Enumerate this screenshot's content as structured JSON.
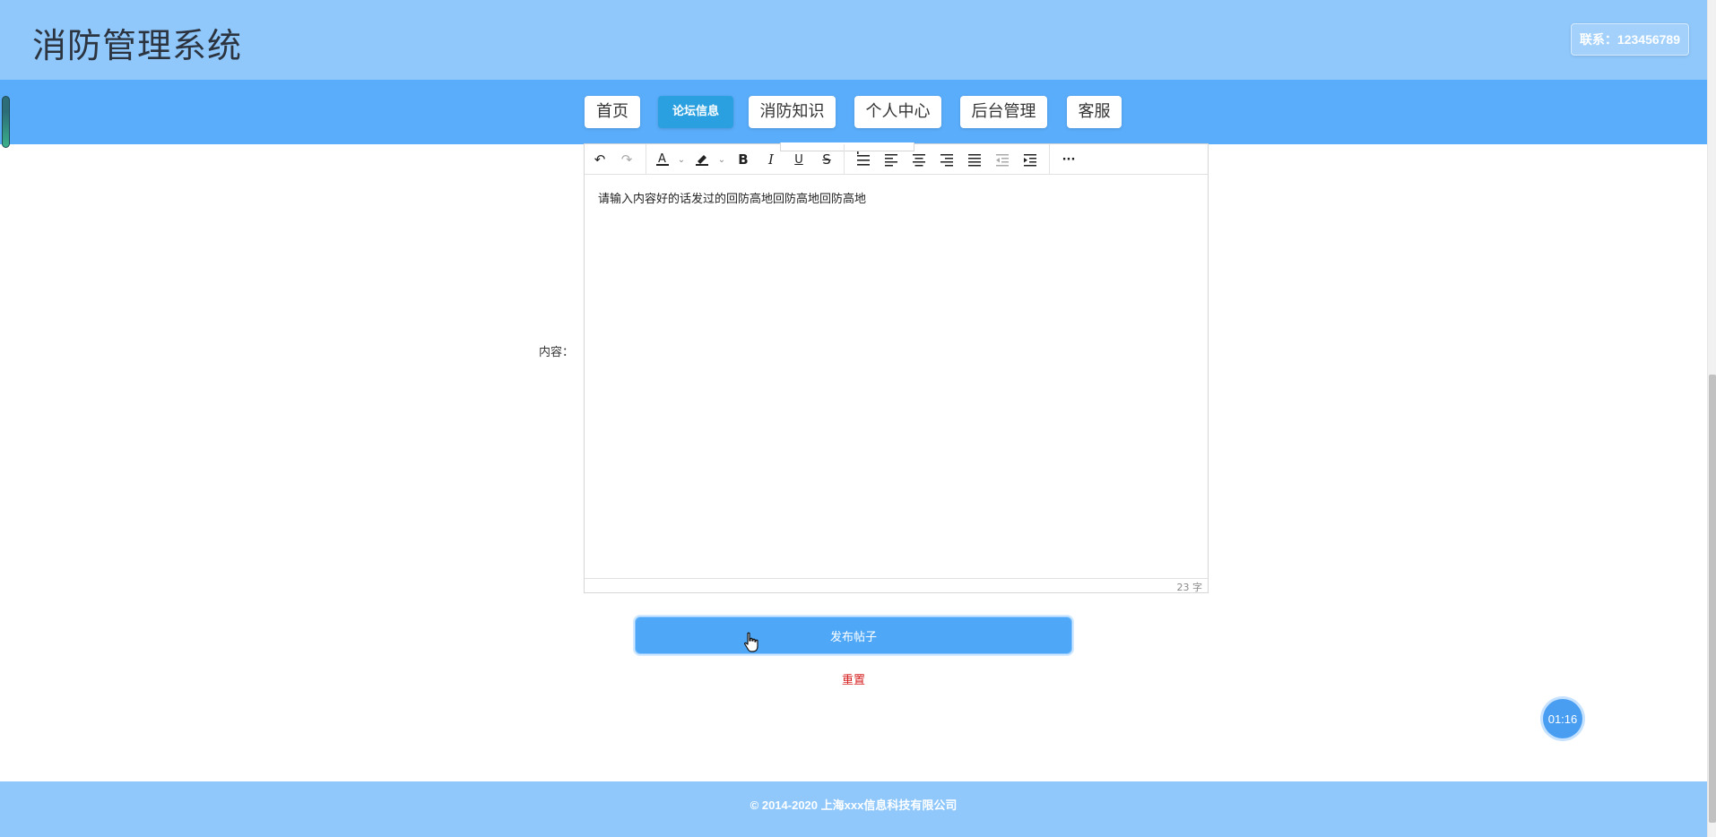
{
  "header": {
    "site_title": "消防管理系统",
    "contact": "联系：123456789"
  },
  "nav": {
    "items": [
      {
        "label": "首页",
        "active": false
      },
      {
        "label": "论坛信息",
        "active": true
      },
      {
        "label": "消防知识",
        "active": false
      },
      {
        "label": "个人中心",
        "active": false
      },
      {
        "label": "后台管理",
        "active": false
      },
      {
        "label": "客服",
        "active": false
      }
    ]
  },
  "form": {
    "content_label": "内容：",
    "editor_text": "请输入内容好的话发过的回防高地回防高地回防高地",
    "word_count": "23 字",
    "submit_label": "发布帖子",
    "reset_label": "重置"
  },
  "toolbar": {
    "undo": "↶",
    "redo": "↷",
    "font_color": "A",
    "bold": "B",
    "italic": "I",
    "underline": "U",
    "strike": "S",
    "more": "···"
  },
  "timer": "01:16",
  "footer": {
    "copyright": "© 2014-2020 上海xxx信息科技有限公司"
  },
  "colors": {
    "header_bg": "#90c8fc",
    "nav_bg": "#5aadfb",
    "active_tab": "#2aa0e0",
    "submit_btn": "#4fa8f7",
    "reset_link": "#d62020"
  }
}
